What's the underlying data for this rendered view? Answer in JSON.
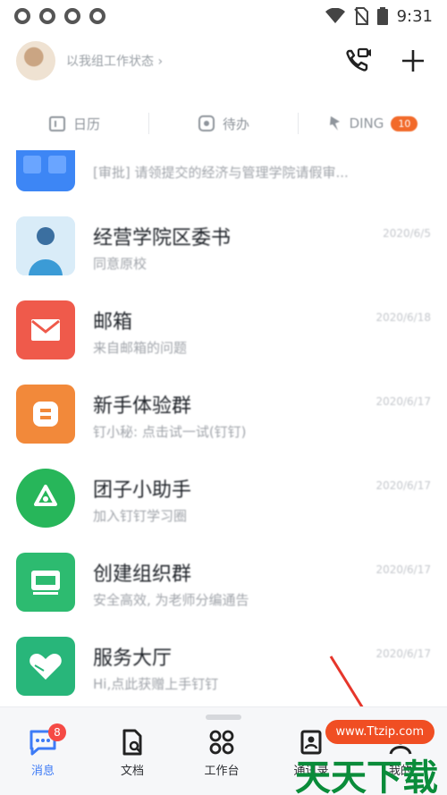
{
  "status_bar": {
    "time": "9:31",
    "icons": [
      "gear-icon",
      "gear-icon",
      "gear-icon",
      "gear-icon",
      "wifi-icon",
      "no-sim-icon",
      "battery-icon"
    ]
  },
  "header": {
    "org_name": "以我组工作状态 ›",
    "actions": [
      "video-call-icon",
      "plus-icon"
    ]
  },
  "quick_actions": [
    {
      "label": "日历",
      "icon": "calendar-icon"
    },
    {
      "label": "待办",
      "icon": "todo-icon"
    },
    {
      "label": "DING",
      "icon": "ding-icon",
      "badge": "10"
    }
  ],
  "conversations": [
    {
      "name": "",
      "preview": "[审批] 请领提交的经济与管理学院请假审...",
      "time": "",
      "avatar_color": "#3d86f5",
      "icon": "approval-icon"
    },
    {
      "name": "经营学院区委书",
      "preview": "同意原校",
      "time": "2020/6/5",
      "avatar_color": "#3b9bd6",
      "icon": "person-photo"
    },
    {
      "name": "邮箱",
      "preview": "来自邮箱的问题",
      "time": "2020/6/18",
      "avatar_color": "#ef5a4b",
      "icon": "mail-icon"
    },
    {
      "name": "新手体验群",
      "preview": "钉小秘: 点击试一试(钉钉)",
      "time": "2020/6/17",
      "avatar_color": "#f2893a",
      "icon": "group-chat-icon"
    },
    {
      "name": "团子小助手",
      "preview": "加入钉钉学习圈",
      "time": "2020/6/17",
      "avatar_color": "#27b65a",
      "icon": "recycle-icon"
    },
    {
      "name": "创建组织群",
      "preview": "安全高效, 为老师分编通告",
      "time": "2020/6/17",
      "avatar_color": "#2dbb70",
      "icon": "org-icon"
    },
    {
      "name": "服务大厅",
      "preview": "Hi,点此获赠上手钉钉",
      "time": "2020/6/17",
      "avatar_color": "#28b67a",
      "icon": "heart-hands-icon"
    }
  ],
  "bottom_nav": {
    "items": [
      {
        "label": "消息",
        "icon": "chat-icon",
        "badge": "8"
      },
      {
        "label": "文档",
        "icon": "document-icon"
      },
      {
        "label": "工作台",
        "icon": "apps-icon"
      },
      {
        "label": "通讯录",
        "icon": "contacts-icon"
      },
      {
        "label": "我的",
        "icon": "profile-icon"
      }
    ]
  },
  "watermark": {
    "site": "www.Ttzip.com",
    "text": "天天下载"
  },
  "colors": {
    "accent": "#3d7bf6",
    "badge": "#f54a45",
    "ding": "#f26a2a",
    "watermark_green": "#0a8c3a"
  }
}
